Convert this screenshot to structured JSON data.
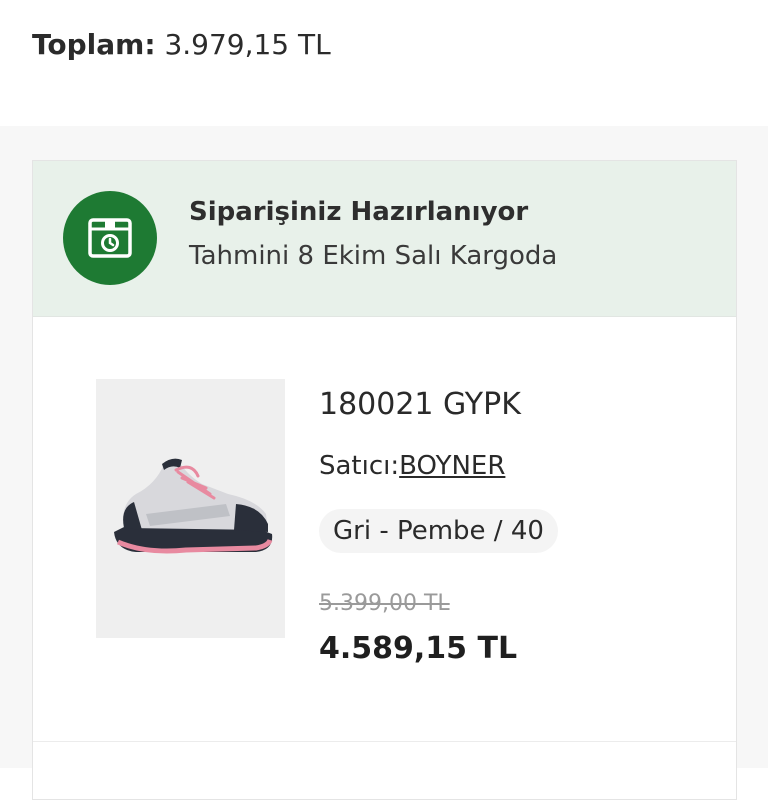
{
  "summary": {
    "total_label": "Toplam:",
    "total_value": "3.979,15 TL"
  },
  "order": {
    "status": {
      "title": "Siparişiniz Hazırlanıyor",
      "subtitle": "Tahmini 8 Ekim Salı Kargoda",
      "icon": "package-clock-icon"
    },
    "item": {
      "name": "180021 GYPK",
      "seller_label": "Satıcı:",
      "seller_name": "BOYNER",
      "variant": "Gri - Pembe / 40",
      "old_price": "5.399,00 TL",
      "new_price": "4.589,15 TL",
      "image": "product-shoe-image"
    }
  },
  "colors": {
    "status_band": "#e8f1ea",
    "status_icon": "#1e7a33",
    "page_background": "#f7f7f7"
  }
}
